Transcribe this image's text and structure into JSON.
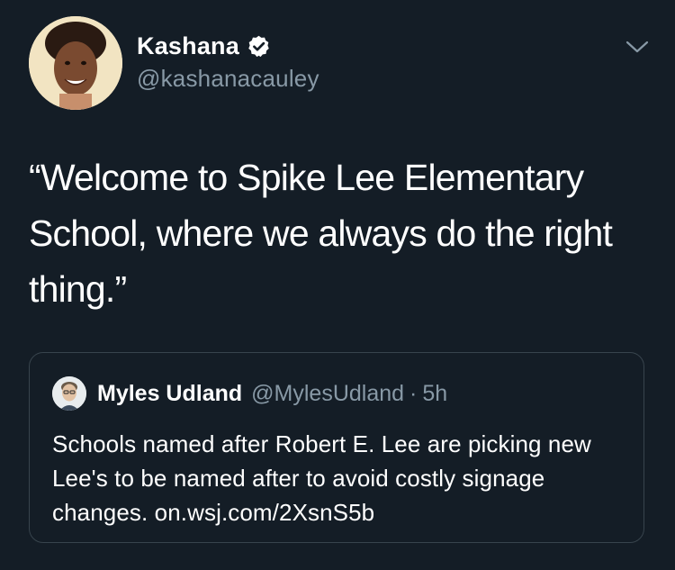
{
  "tweet": {
    "author": {
      "display_name": "Kashana",
      "handle": "@kashanacauley",
      "verified": true
    },
    "text": "“Welcome to Spike Lee Elementary School, where we always do the right thing.”",
    "menu_icon": "chevron-down-icon"
  },
  "quoted_tweet": {
    "author": {
      "display_name": "Myles Udland",
      "handle": "@MylesUdland"
    },
    "separator": "·",
    "time": "5h",
    "text": "Schools named after Robert E. Lee are picking new Lee's to be named after to avoid costly signage changes. on.wsj.com/2XsnS5b"
  },
  "colors": {
    "background": "#141d26",
    "text_primary": "#ffffff",
    "text_secondary": "#8899a6",
    "border": "#38444d",
    "verified_badge": "#ffffff"
  }
}
